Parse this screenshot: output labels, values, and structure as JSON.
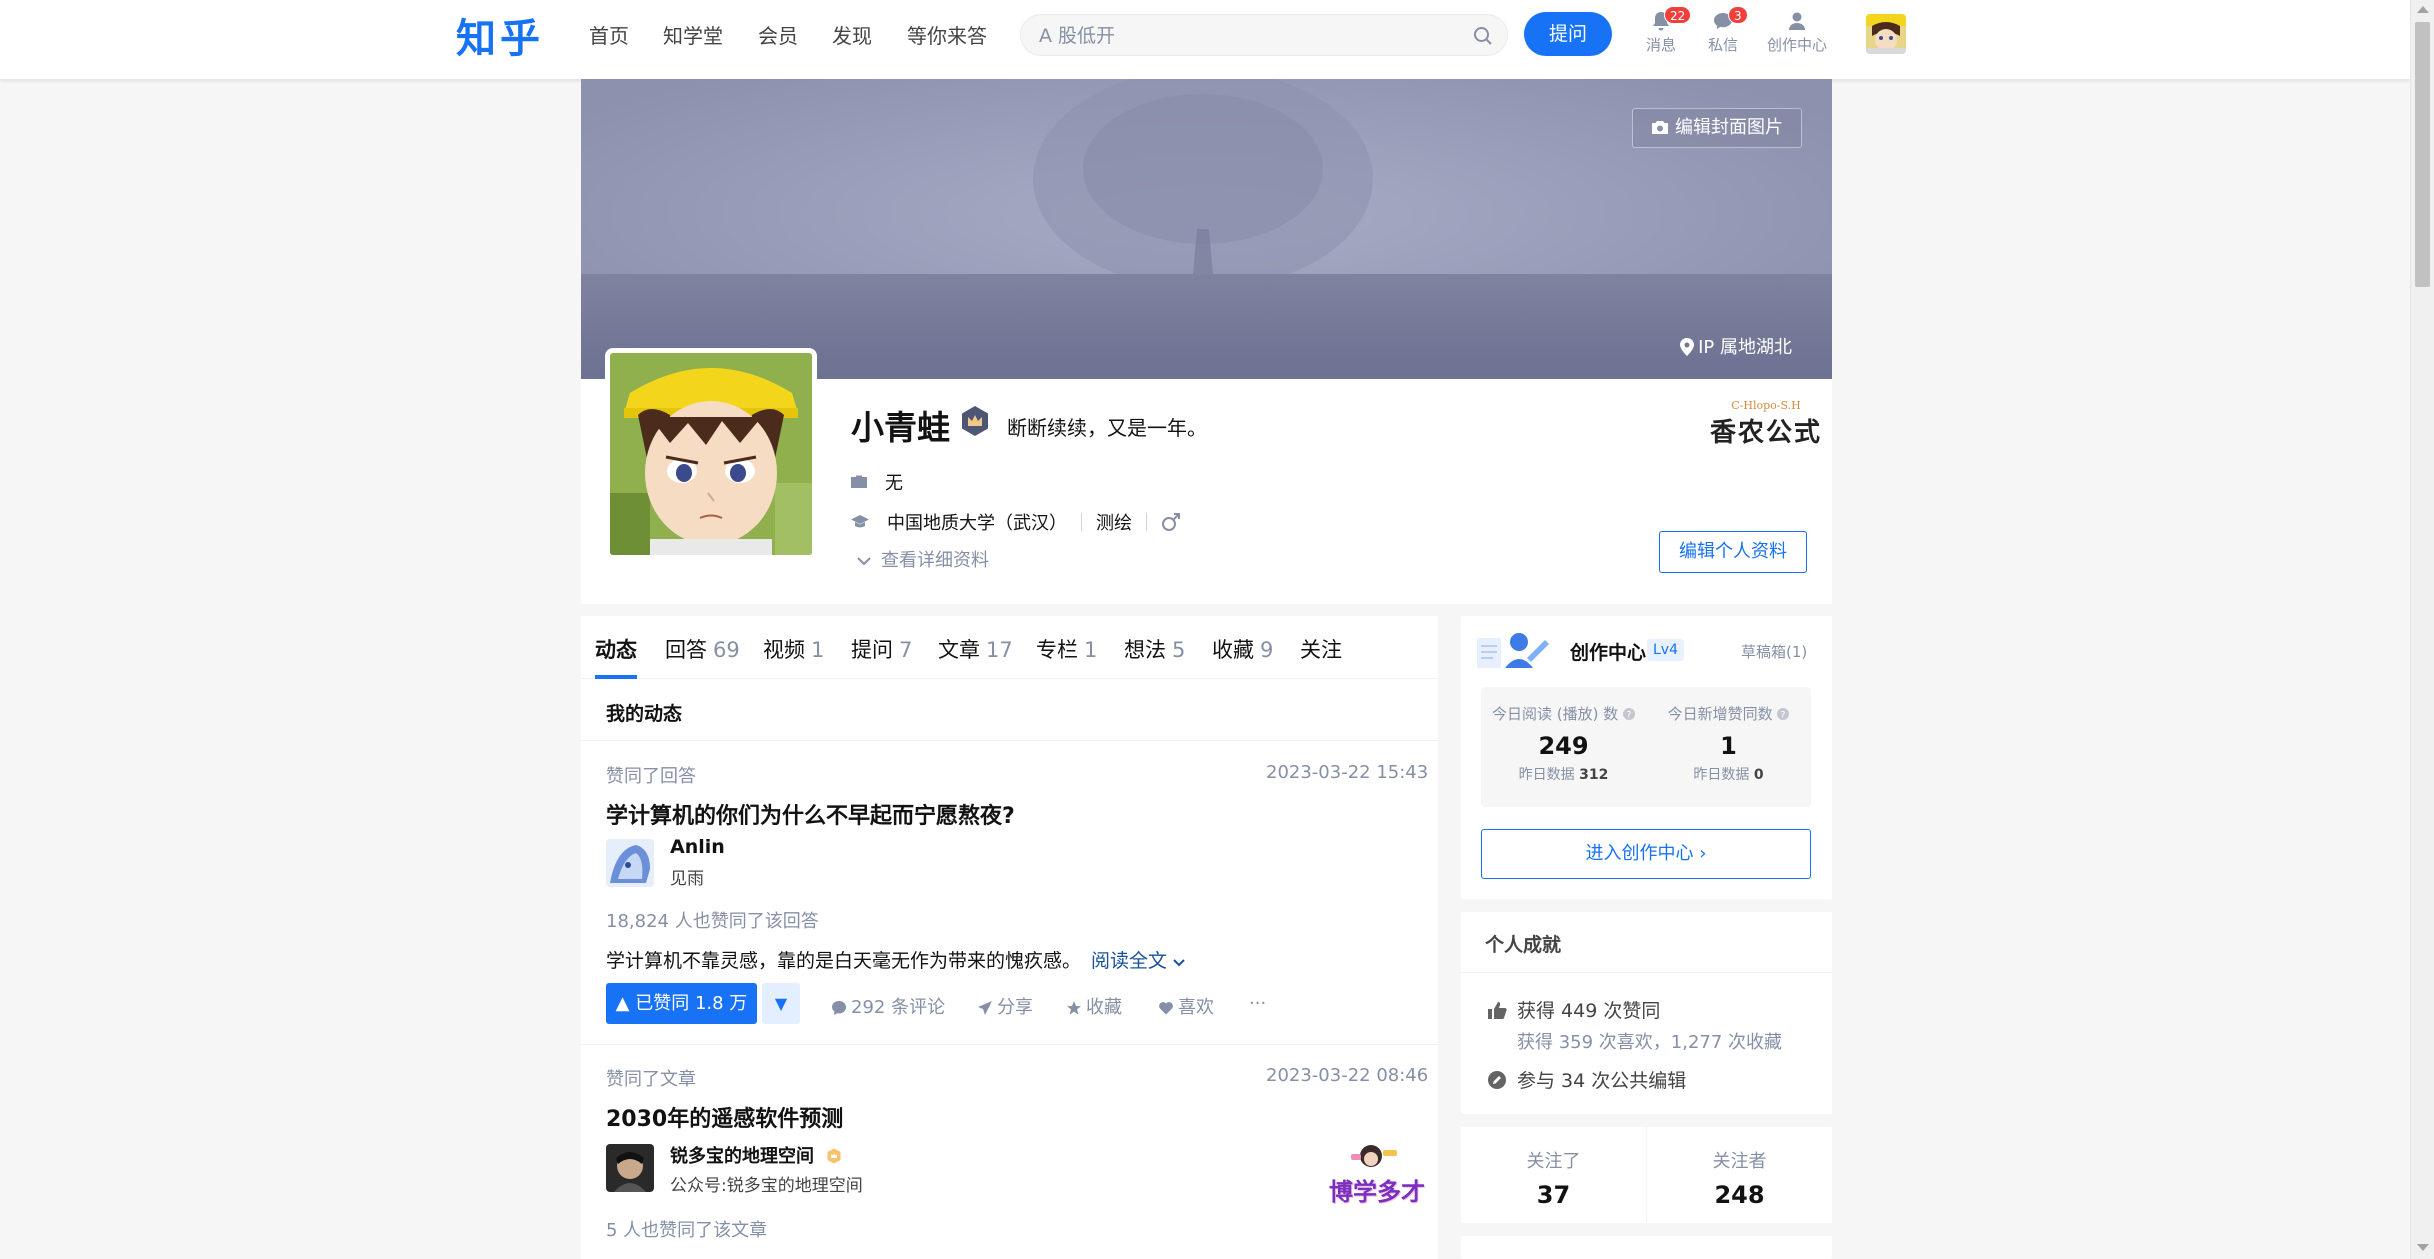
{
  "header": {
    "logo": "知乎",
    "nav": [
      "首页",
      "知学堂",
      "会员",
      "发现",
      "等你来答"
    ],
    "search_placeholder": "A 股低开",
    "ask_label": "提问",
    "icons": [
      {
        "label": "消息",
        "badge": "22",
        "icon": "bell-icon"
      },
      {
        "label": "私信",
        "badge": "3",
        "icon": "chat-icon"
      },
      {
        "label": "创作中心",
        "badge": "",
        "icon": "creator-icon"
      }
    ]
  },
  "profile": {
    "cover_button": "编辑封面图片",
    "ip": "IP 属地湖北",
    "name": "小青蛙",
    "headline": "断断续续，又是一年。",
    "industry": "无",
    "school": "中国地质大学（武汉）",
    "major": "测绘",
    "gender_icon": "male-icon",
    "view_more": "查看详细资料",
    "edit_profile": "编辑个人资料",
    "brand_small": "C-Hlopo-S.H",
    "brand_large": "香农公式"
  },
  "tabs": [
    {
      "label": "动态",
      "count": ""
    },
    {
      "label": "回答",
      "count": "69"
    },
    {
      "label": "视频",
      "count": "1"
    },
    {
      "label": "提问",
      "count": "7"
    },
    {
      "label": "文章",
      "count": "17"
    },
    {
      "label": "专栏",
      "count": "1"
    },
    {
      "label": "想法",
      "count": "5"
    },
    {
      "label": "收藏",
      "count": "9"
    },
    {
      "label": "关注",
      "count": ""
    }
  ],
  "feed": {
    "title": "我的动态",
    "items": [
      {
        "action": "赞同了回答",
        "time": "2023-03-22 15:43",
        "title": "学计算机的你们为什么不早起而宁愿熬夜?",
        "author": "Anlin",
        "author_desc": "见雨",
        "upvote_summary": "18,824 人也赞同了该回答",
        "excerpt": "学计算机不靠灵感，靠的是白天毫无作为带来的愧疚感。",
        "read_more": "阅读全文",
        "vote_label": "▲ 已赞同 1.8 万",
        "comments": "292 条评论",
        "share": "分享",
        "collect": "收藏",
        "like": "喜欢",
        "more": "···"
      },
      {
        "action": "赞同了文章",
        "time": "2023-03-22 08:46",
        "title": "2030年的遥感软件预测",
        "author": "锐多宝的地理空间",
        "author_desc": "公众号:锐多宝的地理空间",
        "upvote_summary": "5 人也赞同了该文章",
        "sticker": "博学多才"
      }
    ]
  },
  "creator": {
    "title": "创作中心",
    "level": "Lv4",
    "drafts": "草稿箱(1)",
    "today_read_label": "今日阅读 (播放) 数",
    "today_read": "249",
    "yesterday_read_label": "昨日数据",
    "yesterday_read": "312",
    "today_upvote_label": "今日新增赞同数",
    "today_upvote": "1",
    "yesterday_upvote_label": "昨日数据",
    "yesterday_upvote": "0",
    "enter_label": "进入创作中心 ›"
  },
  "achievements": {
    "title": "个人成就",
    "upvotes": "获得 449 次赞同",
    "likes": "获得 359 次喜欢，1,277 次收藏",
    "edits": "参与 34 次公共编辑"
  },
  "follow": {
    "following_label": "关注了",
    "following": "37",
    "followers_label": "关注者",
    "followers": "248"
  },
  "colors": {
    "brand": "#1772f6",
    "badge": "#f1403c",
    "text_gray": "#8590a6"
  }
}
